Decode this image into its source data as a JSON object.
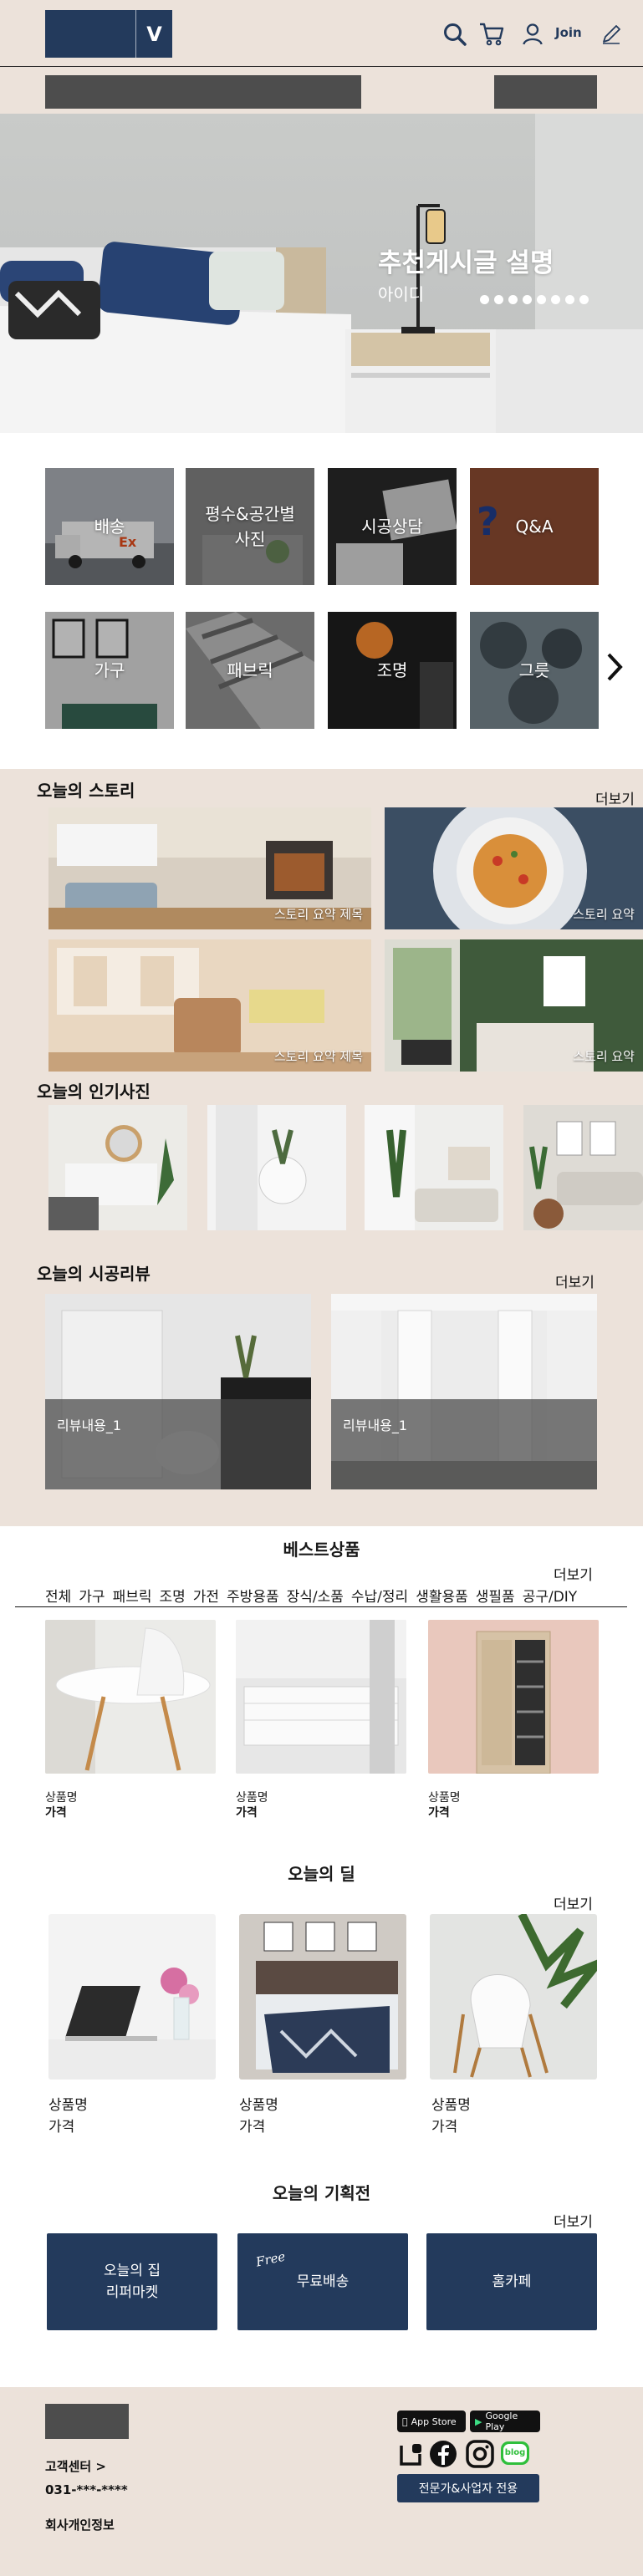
{
  "header": {
    "logo_letter": "V",
    "join_label": "Join",
    "icons": [
      "search-icon",
      "cart-icon",
      "user-icon",
      "pen-icon"
    ]
  },
  "hero": {
    "title": "추천게시글 설명",
    "subtitle": "아이디",
    "dot_count": 8
  },
  "categories": [
    {
      "label": "배송"
    },
    {
      "label": "평수&공간별\n사진"
    },
    {
      "label": "시공상담"
    },
    {
      "label": "Q&A"
    },
    {
      "label": "가구"
    },
    {
      "label": "패브릭"
    },
    {
      "label": "조명"
    },
    {
      "label": "그릇"
    }
  ],
  "story": {
    "title": "오늘의 스토리",
    "more": "더보기",
    "items": [
      {
        "caption": "스토리 요약 제목"
      },
      {
        "caption": "스토리 요약"
      },
      {
        "caption": "스토리 요약 제목"
      },
      {
        "caption": "스토리 요약"
      }
    ]
  },
  "popular": {
    "title": "오늘의 인기사진"
  },
  "review": {
    "title": "오늘의 시공리뷰",
    "more": "더보기",
    "items": [
      {
        "text": "리뷰내용_1"
      },
      {
        "text": "리뷰내용_1"
      }
    ]
  },
  "best": {
    "title": "베스트상품",
    "more": "더보기",
    "tabs": [
      "전체",
      "가구",
      "패브릭",
      "조명",
      "가전",
      "주방용품",
      "장식/소품",
      "수납/정리",
      "생활용품",
      "생필품",
      "공구/DIY"
    ],
    "products": [
      {
        "name": "상품명",
        "price": "가격"
      },
      {
        "name": "상품명",
        "price": "가격"
      },
      {
        "name": "상품명",
        "price": "가격"
      }
    ]
  },
  "deal": {
    "title": "오늘의 딜",
    "more": "더보기",
    "products": [
      {
        "name": "상품명",
        "price": "가격"
      },
      {
        "name": "상품명",
        "price": "가격"
      },
      {
        "name": "상품명",
        "price": "가격"
      }
    ]
  },
  "plan": {
    "title": "오늘의 기획전",
    "more": "더보기",
    "free_badge": "Free",
    "items": [
      {
        "label": "오늘의 집\n리퍼마켓"
      },
      {
        "label": "무료배송"
      },
      {
        "label": "홈카페"
      }
    ]
  },
  "footer": {
    "customer_center": "고객센터 >",
    "phone": "031-***-****",
    "company_info": "회사개인정보",
    "app_store": "App Store",
    "google_play": "Google Play",
    "social_icons": [
      "instagram-like-icon",
      "facebook-icon",
      "instagram-icon",
      "blog-icon"
    ],
    "blog_label": "blog",
    "pro_button": "전문가&사업자 전용"
  },
  "colors": {
    "navy": "#233a5c",
    "background": "#ece2da",
    "placeholder_gray": "#4d4d4d"
  }
}
